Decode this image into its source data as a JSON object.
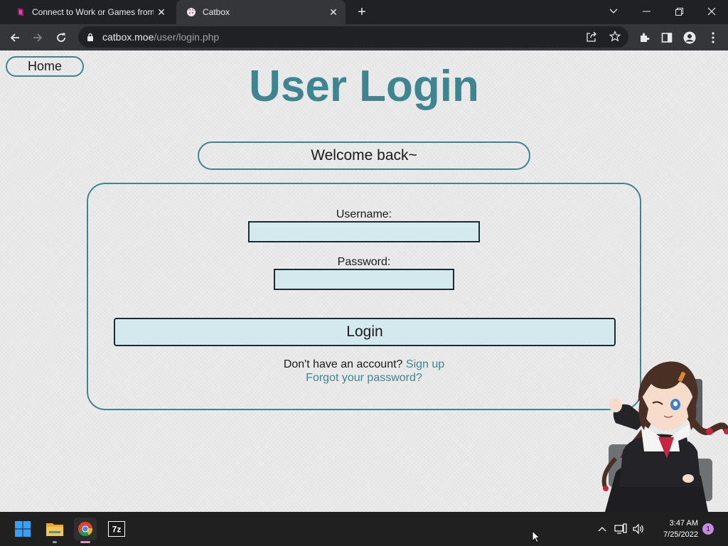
{
  "browser": {
    "tabs": [
      {
        "title": "Connect to Work or Games from",
        "favicon": "parsec-icon",
        "active": false
      },
      {
        "title": "Catbox",
        "favicon": "catbox-icon",
        "active": true
      }
    ],
    "url_host": "catbox.moe",
    "url_path": "/user/login.php"
  },
  "page": {
    "home_label": "Home",
    "title": "User Login",
    "welcome": "Welcome back~",
    "username_label": "Username:",
    "username_value": "",
    "password_label": "Password:",
    "password_value": "",
    "login_label": "Login",
    "no_account_text": "Don't have an account?",
    "signup_label": "Sign up",
    "forgot_label": "Forgot your password?"
  },
  "colors": {
    "accent": "#3d8590",
    "input_bg": "#d4e9ee",
    "page_bg": "#ebebeb"
  },
  "taskbar": {
    "apps": [
      "windows-start-icon",
      "file-explorer-icon",
      "chrome-icon",
      "7zip-icon"
    ],
    "time": "3:47 AM",
    "date": "7/25/2022",
    "notification_count": "1"
  }
}
